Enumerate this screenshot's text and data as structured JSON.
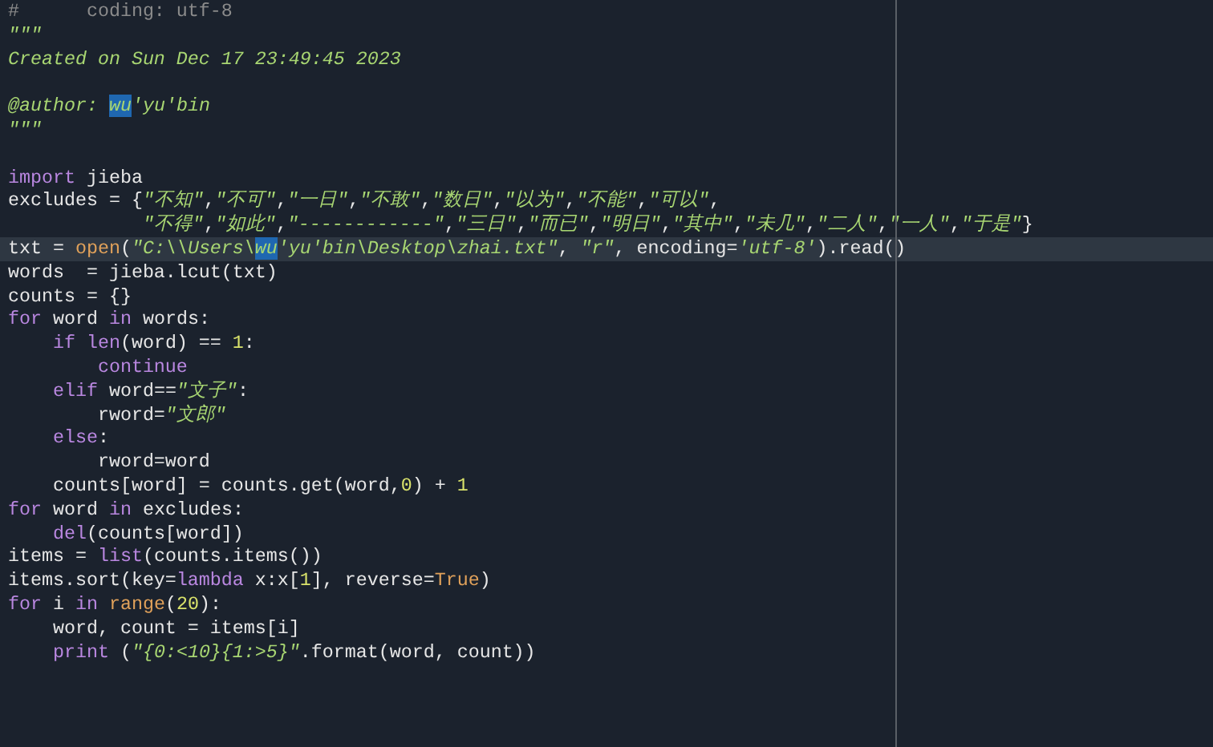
{
  "editor": {
    "lines": [
      {
        "kind": "code",
        "current": false,
        "tokens": [
          {
            "kind": "comment",
            "text": "#      coding: utf-8"
          }
        ]
      },
      {
        "kind": "code",
        "current": false,
        "tokens": [
          {
            "kind": "doc",
            "text": "\"\"\""
          }
        ]
      },
      {
        "kind": "code",
        "current": false,
        "tokens": [
          {
            "kind": "doc",
            "text": "Created on Sun Dec 17 23:49:45 2023"
          }
        ]
      },
      {
        "kind": "blank",
        "current": false
      },
      {
        "kind": "code",
        "current": false,
        "tokens": [
          {
            "kind": "doc",
            "text": "@author: "
          },
          {
            "kind": "match",
            "text": "wu"
          },
          {
            "kind": "doc",
            "text": "'yu'bin"
          }
        ]
      },
      {
        "kind": "code",
        "current": false,
        "tokens": [
          {
            "kind": "doc",
            "text": "\"\"\""
          }
        ]
      },
      {
        "kind": "blank",
        "current": false
      },
      {
        "kind": "code",
        "current": false,
        "tokens": [
          {
            "kind": "keyword",
            "text": "import"
          },
          {
            "kind": "plain",
            "text": " jieba"
          }
        ]
      },
      {
        "kind": "code",
        "current": false,
        "tokens": [
          {
            "kind": "plain",
            "text": "excludes = {"
          },
          {
            "kind": "string",
            "text": "\"不知\""
          },
          {
            "kind": "plain",
            "text": ","
          },
          {
            "kind": "string",
            "text": "\"不可\""
          },
          {
            "kind": "plain",
            "text": ","
          },
          {
            "kind": "string",
            "text": "\"一日\""
          },
          {
            "kind": "plain",
            "text": ","
          },
          {
            "kind": "string",
            "text": "\"不敢\""
          },
          {
            "kind": "plain",
            "text": ","
          },
          {
            "kind": "string",
            "text": "\"数日\""
          },
          {
            "kind": "plain",
            "text": ","
          },
          {
            "kind": "string",
            "text": "\"以为\""
          },
          {
            "kind": "plain",
            "text": ","
          },
          {
            "kind": "string",
            "text": "\"不能\""
          },
          {
            "kind": "plain",
            "text": ","
          },
          {
            "kind": "string",
            "text": "\"可以\""
          },
          {
            "kind": "plain",
            "text": ","
          }
        ]
      },
      {
        "kind": "code",
        "current": false,
        "tokens": [
          {
            "kind": "string",
            "text": "            \"不得\""
          },
          {
            "kind": "plain",
            "text": ","
          },
          {
            "kind": "string",
            "text": "\"如此\""
          },
          {
            "kind": "plain",
            "text": ","
          },
          {
            "kind": "string",
            "text": "\"------------\""
          },
          {
            "kind": "plain",
            "text": ","
          },
          {
            "kind": "string",
            "text": "\"三日\""
          },
          {
            "kind": "plain",
            "text": ","
          },
          {
            "kind": "string",
            "text": "\"而已\""
          },
          {
            "kind": "plain",
            "text": ","
          },
          {
            "kind": "string",
            "text": "\"明日\""
          },
          {
            "kind": "plain",
            "text": ","
          },
          {
            "kind": "string",
            "text": "\"其中\""
          },
          {
            "kind": "plain",
            "text": ","
          },
          {
            "kind": "string",
            "text": "\"未几\""
          },
          {
            "kind": "plain",
            "text": ","
          },
          {
            "kind": "string",
            "text": "\"二人\""
          },
          {
            "kind": "plain",
            "text": ","
          },
          {
            "kind": "string",
            "text": "\"一人\""
          },
          {
            "kind": "plain",
            "text": ","
          },
          {
            "kind": "string",
            "text": "\"于是\""
          },
          {
            "kind": "plain",
            "text": "}"
          }
        ]
      },
      {
        "kind": "code",
        "current": true,
        "tokens": [
          {
            "kind": "plain",
            "text": "txt = "
          },
          {
            "kind": "function",
            "text": "open"
          },
          {
            "kind": "plain",
            "text": "("
          },
          {
            "kind": "string",
            "text": "\"C:\\\\Users\\"
          },
          {
            "kind": "match",
            "text": "wu"
          },
          {
            "kind": "string",
            "text": "'yu'bin\\Desktop\\zhai.txt\""
          },
          {
            "kind": "plain",
            "text": ", "
          },
          {
            "kind": "string",
            "text": "\"r\""
          },
          {
            "kind": "plain",
            "text": ", encoding="
          },
          {
            "kind": "string",
            "text": "'utf-8'"
          },
          {
            "kind": "plain",
            "text": ").read()"
          }
        ]
      },
      {
        "kind": "code",
        "current": false,
        "tokens": [
          {
            "kind": "plain",
            "text": "words  = jieba.lcut(txt)"
          }
        ]
      },
      {
        "kind": "code",
        "current": false,
        "tokens": [
          {
            "kind": "plain",
            "text": "counts = {}"
          }
        ]
      },
      {
        "kind": "code",
        "current": false,
        "tokens": [
          {
            "kind": "keyword",
            "text": "for"
          },
          {
            "kind": "plain",
            "text": " word "
          },
          {
            "kind": "keyword",
            "text": "in"
          },
          {
            "kind": "plain",
            "text": " words:"
          }
        ]
      },
      {
        "kind": "code",
        "current": false,
        "tokens": [
          {
            "kind": "keyword",
            "text": "    if"
          },
          {
            "kind": "keyword",
            "text": " len"
          },
          {
            "kind": "plain",
            "text": "(word) == "
          },
          {
            "kind": "number",
            "text": "1"
          },
          {
            "kind": "plain",
            "text": ":"
          }
        ]
      },
      {
        "kind": "code",
        "current": false,
        "tokens": [
          {
            "kind": "keyword",
            "text": "        continue"
          }
        ]
      },
      {
        "kind": "code",
        "current": false,
        "tokens": [
          {
            "kind": "keyword",
            "text": "    elif"
          },
          {
            "kind": "plain",
            "text": " word=="
          },
          {
            "kind": "string",
            "text": "\"文子\""
          },
          {
            "kind": "plain",
            "text": ":"
          }
        ]
      },
      {
        "kind": "code",
        "current": false,
        "tokens": [
          {
            "kind": "plain",
            "text": "        rword="
          },
          {
            "kind": "string",
            "text": "\"文郎\""
          }
        ]
      },
      {
        "kind": "code",
        "current": false,
        "tokens": [
          {
            "kind": "keyword",
            "text": "    else"
          },
          {
            "kind": "plain",
            "text": ":"
          }
        ]
      },
      {
        "kind": "code",
        "current": false,
        "tokens": [
          {
            "kind": "plain",
            "text": "        rword=word"
          }
        ]
      },
      {
        "kind": "code",
        "current": false,
        "tokens": [
          {
            "kind": "plain",
            "text": "    counts[word] = counts.get(word,"
          },
          {
            "kind": "number",
            "text": "0"
          },
          {
            "kind": "plain",
            "text": ") + "
          },
          {
            "kind": "number",
            "text": "1"
          }
        ]
      },
      {
        "kind": "code",
        "current": false,
        "tokens": [
          {
            "kind": "keyword",
            "text": "for"
          },
          {
            "kind": "plain",
            "text": " word "
          },
          {
            "kind": "keyword",
            "text": "in"
          },
          {
            "kind": "plain",
            "text": " excludes:"
          }
        ]
      },
      {
        "kind": "code",
        "current": false,
        "tokens": [
          {
            "kind": "keyword",
            "text": "    del"
          },
          {
            "kind": "plain",
            "text": "(counts[word])"
          }
        ]
      },
      {
        "kind": "code",
        "current": false,
        "tokens": [
          {
            "kind": "plain",
            "text": "items = "
          },
          {
            "kind": "keyword",
            "text": "list"
          },
          {
            "kind": "plain",
            "text": "(counts.items())"
          }
        ]
      },
      {
        "kind": "code",
        "current": false,
        "tokens": [
          {
            "kind": "plain",
            "text": "items.sort(key="
          },
          {
            "kind": "keyword",
            "text": "lambda"
          },
          {
            "kind": "plain",
            "text": " x:x["
          },
          {
            "kind": "number",
            "text": "1"
          },
          {
            "kind": "plain",
            "text": "], reverse="
          },
          {
            "kind": "constant",
            "text": "True"
          },
          {
            "kind": "plain",
            "text": ")"
          }
        ]
      },
      {
        "kind": "code",
        "current": false,
        "tokens": [
          {
            "kind": "keyword",
            "text": "for"
          },
          {
            "kind": "plain",
            "text": " i "
          },
          {
            "kind": "keyword",
            "text": "in"
          },
          {
            "kind": "function",
            "text": " range"
          },
          {
            "kind": "plain",
            "text": "("
          },
          {
            "kind": "number",
            "text": "20"
          },
          {
            "kind": "plain",
            "text": "):"
          }
        ]
      },
      {
        "kind": "code",
        "current": false,
        "tokens": [
          {
            "kind": "plain",
            "text": "    word, count = items[i]"
          }
        ]
      },
      {
        "kind": "code",
        "current": false,
        "tokens": [
          {
            "kind": "keyword",
            "text": "    print"
          },
          {
            "kind": "plain",
            "text": " ("
          },
          {
            "kind": "string",
            "text": "\"{0:<10}{1:>5}\""
          },
          {
            "kind": "plain",
            "text": ".format(word, count))"
          }
        ]
      }
    ]
  }
}
